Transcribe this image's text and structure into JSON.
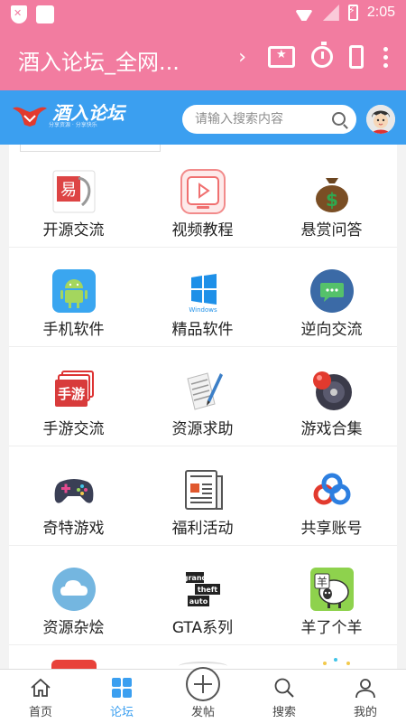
{
  "status_bar": {
    "time": "2:05"
  },
  "title_bar": {
    "title": "酒入论坛_全网..."
  },
  "header": {
    "logo_text": "酒入论坛",
    "logo_sub": "分享资源 · 分享快乐",
    "search_placeholder": "请输入搜索内容"
  },
  "grid": {
    "rows": [
      [
        {
          "label": "开源交流",
          "icon": "open-source-icon"
        },
        {
          "label": "视频教程",
          "icon": "video-play-icon"
        },
        {
          "label": "悬赏问答",
          "icon": "money-bag-icon"
        }
      ],
      [
        {
          "label": "手机软件",
          "icon": "android-icon"
        },
        {
          "label": "精品软件",
          "icon": "windows-icon"
        },
        {
          "label": "逆向交流",
          "icon": "chat-bubble-icon"
        }
      ],
      [
        {
          "label": "手游交流",
          "icon": "mobile-game-icon"
        },
        {
          "label": "资源求助",
          "icon": "document-pen-icon"
        },
        {
          "label": "游戏合集",
          "icon": "game-disc-icon"
        }
      ],
      [
        {
          "label": "奇特游戏",
          "icon": "gamepad-icon"
        },
        {
          "label": "福利活动",
          "icon": "newspaper-icon"
        },
        {
          "label": "共享账号",
          "icon": "share-cloud-icon"
        }
      ],
      [
        {
          "label": "资源杂烩",
          "icon": "cloud-icon"
        },
        {
          "label": "GTA系列",
          "icon": "gta-logo-icon"
        },
        {
          "label": "羊了个羊",
          "icon": "sheep-icon"
        }
      ]
    ]
  },
  "bottom_nav": [
    {
      "label": "首页",
      "icon": "home-icon"
    },
    {
      "label": "论坛",
      "icon": "grid-icon"
    },
    {
      "label": "发帖",
      "icon": "plus-circle-icon"
    },
    {
      "label": "搜索",
      "icon": "search-icon"
    },
    {
      "label": "我的",
      "icon": "user-icon"
    }
  ],
  "colors": {
    "accent": "#f27ca0",
    "header_blue": "#3b9ff0",
    "active_nav": "#3b9ff0"
  }
}
